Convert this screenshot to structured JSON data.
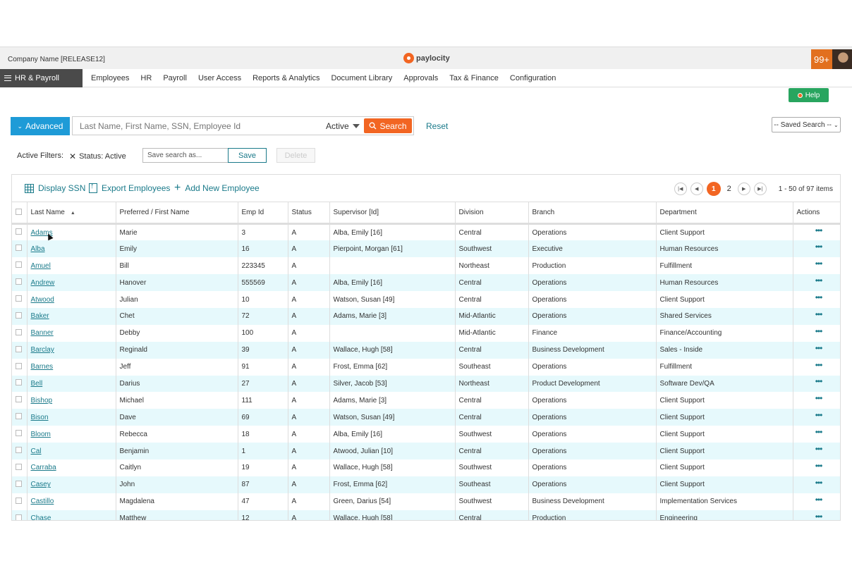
{
  "header": {
    "company": "Company Name [RELEASE12]",
    "logo_text": "paylocity",
    "notifications": "99+"
  },
  "nav": {
    "module": "HR & Payroll",
    "items": [
      "Employees",
      "HR",
      "Payroll",
      "User Access",
      "Reports & Analytics",
      "Document Library",
      "Approvals",
      "Tax & Finance",
      "Configuration"
    ]
  },
  "help_label": "Help",
  "search": {
    "advanced_label": "Advanced",
    "placeholder": "Last Name, First Name, SSN, Employee Id",
    "status": "Active",
    "search_label": "Search",
    "reset_label": "Reset",
    "saved_search": "-- Saved Search --"
  },
  "filters": {
    "label": "Active Filters:",
    "chip": "Status: Active",
    "save_placeholder": "Save search as...",
    "save_label": "Save",
    "delete_label": "Delete"
  },
  "toolbar": {
    "display_ssn": "Display SSN",
    "export": "Export Employees",
    "add": "Add New Employee"
  },
  "pager": {
    "current": "1",
    "next_page": "2",
    "info": "1 - 50 of 97 items"
  },
  "table": {
    "columns": [
      "Last Name",
      "Preferred / First Name",
      "Emp Id",
      "Status",
      "Supervisor [Id]",
      "Division",
      "Branch",
      "Department",
      "Actions"
    ],
    "rows": [
      [
        "Adams",
        "Marie",
        "3",
        "A",
        "Alba, Emily [16]",
        "Central",
        "Operations",
        "Client Support"
      ],
      [
        "Alba",
        "Emily",
        "16",
        "A",
        "Pierpoint, Morgan [61]",
        "Southwest",
        "Executive",
        "Human Resources"
      ],
      [
        "Amuel",
        "Bill",
        "223345",
        "A",
        "",
        "Northeast",
        "Production",
        "Fulfillment"
      ],
      [
        "Andrew",
        "Hanover",
        "555569",
        "A",
        "Alba, Emily [16]",
        "Central",
        "Operations",
        "Human Resources"
      ],
      [
        "Atwood",
        "Julian",
        "10",
        "A",
        "Watson, Susan [49]",
        "Central",
        "Operations",
        "Client Support"
      ],
      [
        "Baker",
        "Chet",
        "72",
        "A",
        "Adams, Marie [3]",
        "Mid-Atlantic",
        "Operations",
        "Shared Services"
      ],
      [
        "Banner",
        "Debby",
        "100",
        "A",
        "",
        "Mid-Atlantic",
        "Finance",
        "Finance/Accounting"
      ],
      [
        "Barclay",
        "Reginald",
        "39",
        "A",
        "Wallace, Hugh [58]",
        "Central",
        "Business Development",
        "Sales - Inside"
      ],
      [
        "Barnes",
        "Jeff",
        "91",
        "A",
        "Frost, Emma [62]",
        "Southeast",
        "Operations",
        "Fulfillment"
      ],
      [
        "Bell",
        "Darius",
        "27",
        "A",
        "Silver, Jacob [53]",
        "Northeast",
        "Product Development",
        "Software Dev/QA"
      ],
      [
        "Bishop",
        "Michael",
        "111",
        "A",
        "Adams, Marie [3]",
        "Central",
        "Operations",
        "Client Support"
      ],
      [
        "Bison",
        "Dave",
        "69",
        "A",
        "Watson, Susan [49]",
        "Central",
        "Operations",
        "Client Support"
      ],
      [
        "Bloom",
        "Rebecca",
        "18",
        "A",
        "Alba, Emily [16]",
        "Southwest",
        "Operations",
        "Client Support"
      ],
      [
        "Cal",
        "Benjamin",
        "1",
        "A",
        "Atwood, Julian [10]",
        "Central",
        "Operations",
        "Client Support"
      ],
      [
        "Carraba",
        "Caitlyn",
        "19",
        "A",
        "Wallace, Hugh [58]",
        "Southwest",
        "Operations",
        "Client Support"
      ],
      [
        "Casey",
        "John",
        "87",
        "A",
        "Frost, Emma [62]",
        "Southeast",
        "Operations",
        "Client Support"
      ],
      [
        "Castillo",
        "Magdalena",
        "47",
        "A",
        "Green, Darius [54]",
        "Southwest",
        "Business Development",
        "Implementation Services"
      ],
      [
        "Chase",
        "Matthew",
        "12",
        "A",
        "Wallace, Hugh [58]",
        "Central",
        "Production",
        "Engineering"
      ]
    ],
    "actions_glyph": "•••"
  }
}
